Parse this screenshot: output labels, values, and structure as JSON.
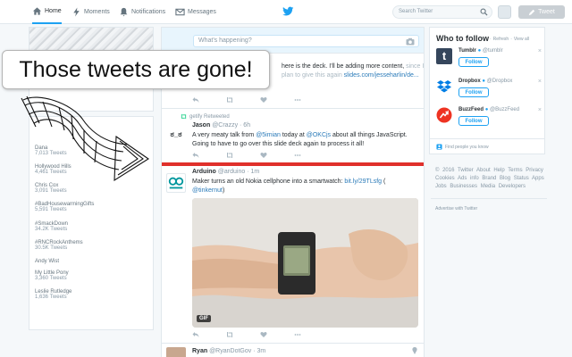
{
  "nav": {
    "home": "Home",
    "moments": "Moments",
    "notifications": "Notifications",
    "messages": "Messages",
    "search_placeholder": "Search Twitter",
    "tweet_button": "Tweet"
  },
  "callout": {
    "text": "Those tweets are gone!"
  },
  "composer": {
    "placeholder": "What's happening?"
  },
  "trends": [
    {
      "name": "Dana",
      "count": "7,013 Tweets"
    },
    {
      "name": "Hollywood Hills",
      "count": "4,461 Tweets"
    },
    {
      "name": "Chris Cox",
      "count": "3,091 Tweets"
    },
    {
      "name": "#BadHousewarmingGifts",
      "count": "5,591 Tweets"
    },
    {
      "name": "#SmackDown",
      "count": "34.2K Tweets"
    },
    {
      "name": "#RNCRockAnthems",
      "count": "30.5K Tweets"
    },
    {
      "name": "Andy Wist",
      "count": ""
    },
    {
      "name": "My Little Pony",
      "count": "3,360 Tweets"
    },
    {
      "name": "Leslie Rutledge",
      "count": "1,636 Tweets"
    }
  ],
  "tweet1": {
    "text_a": "here is the deck. I'll be adding more content, ",
    "text_b": "since I plan to give this again ",
    "link": "slides.com/jesseharlin/de..."
  },
  "tweet2": {
    "retweeted_by": "getify Retweeted",
    "avatar_text": "ಠ_ಠ",
    "name": "Jason",
    "handle": "@Crazzy",
    "time": "· 6h",
    "text_a": "A very meaty talk from ",
    "mention1": "@5imian",
    "text_b": " today at ",
    "mention2": "@OKCjs",
    "text_c": " about all things JavaScript. Going to have to go over this slide deck again to process it all!"
  },
  "tweet3": {
    "name": "Arduino",
    "handle": "@arduino",
    "time": "· 1m",
    "text": "Maker turns an old Nokia cellphone into a smartwatch: ",
    "link": "bit.ly/29TLsfg",
    "text_end": " ( ",
    "mention": "@tinkernut",
    "text_close": ")",
    "media_badge": "GIF"
  },
  "tweet4": {
    "name": "Ryan",
    "handle": "@RyanDotGov",
    "time": "· 3m"
  },
  "who_to_follow": {
    "title": "Who to follow",
    "refresh": "Refresh",
    "view_all": "View all",
    "follow_label": "Follow",
    "suggestions": [
      {
        "name": "Tumblr",
        "handle": "@tumblr",
        "color": "#35465c",
        "glyph": "t"
      },
      {
        "name": "Dropbox",
        "handle": "@Dropbox",
        "color": "#007ee5",
        "glyph": ""
      },
      {
        "name": "BuzzFeed",
        "handle": "@BuzzFeed",
        "color": "#ee3322",
        "glyph": ""
      }
    ],
    "find_people": "Find people you know"
  },
  "footer": {
    "links": "© 2016 Twitter About Help Terms Privacy Cookies Ads info Brand Blog Status Apps Jobs Businesses Media Developers",
    "advertise": "Advertise with Twitter"
  },
  "colors": {
    "accent": "#1da1f2",
    "red_bar": "#e0302b"
  }
}
